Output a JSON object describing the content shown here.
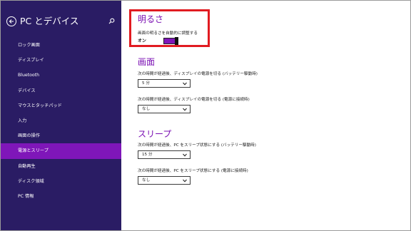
{
  "sidebar": {
    "title": "PC とデバイス",
    "items": [
      {
        "label": "ロック画面",
        "active": false
      },
      {
        "label": "ディスプレイ",
        "active": false
      },
      {
        "label": "Bluetooth",
        "active": false
      },
      {
        "label": "デバイス",
        "active": false
      },
      {
        "label": "マウスとタッチパッド",
        "active": false
      },
      {
        "label": "入力",
        "active": false
      },
      {
        "label": "画面の操作",
        "active": false
      },
      {
        "label": "電源とスリープ",
        "active": true
      },
      {
        "label": "自動再生",
        "active": false
      },
      {
        "label": "ディスク領域",
        "active": false
      },
      {
        "label": "PC 情報",
        "active": false
      }
    ]
  },
  "brightness": {
    "title": "明るさ",
    "auto_label": "画面の明るさを自動的に調整する",
    "toggle_state": "オン"
  },
  "screen": {
    "title": "画面",
    "battery_label": "次の時間が経過後、ディスプレイの電源を切る (バッテリー駆動時)",
    "battery_value": "5 分",
    "plugged_label": "次の時間が経過後、ディスプレイの電源を切る (電源に接続時)",
    "plugged_value": "なし"
  },
  "sleep": {
    "title": "スリープ",
    "battery_label": "次の時間が経過後、PC をスリープ状態にする (バッテリー駆動時)",
    "battery_value": "15 分",
    "plugged_label": "次の時間が経過後、PC をスリープ状態にする (電源に接続時)",
    "plugged_value": "なし"
  },
  "colors": {
    "sidebar_bg": "#2a1c64",
    "accent": "#7f16b9",
    "highlight_border": "#e11b21"
  },
  "icons": {
    "back": "back-arrow-icon",
    "search": "search-icon",
    "dropdown": "chevron-down-icon"
  }
}
